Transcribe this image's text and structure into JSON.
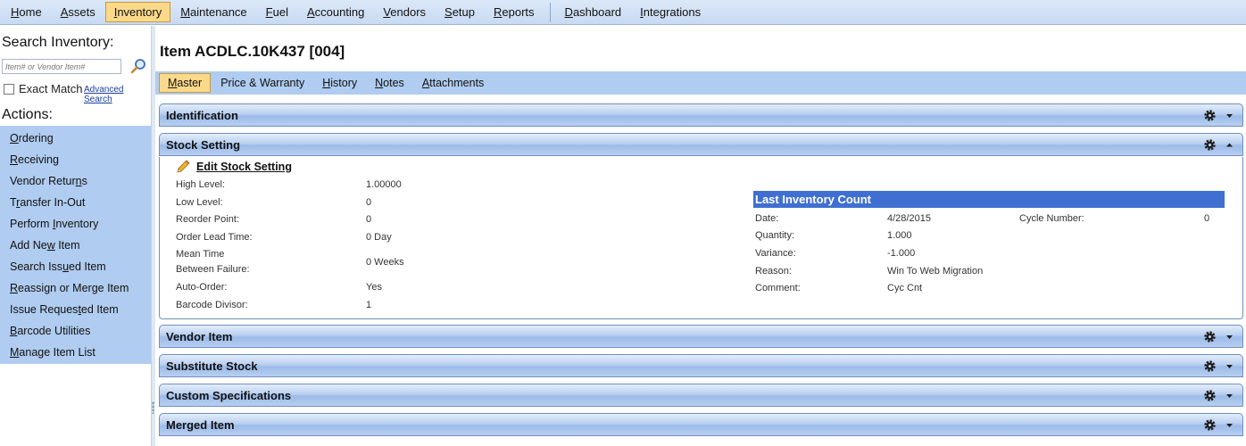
{
  "menu": {
    "items": [
      {
        "label": "Home",
        "key": "H",
        "rest": "ome"
      },
      {
        "label": "Assets",
        "key": "A",
        "rest": "ssets"
      },
      {
        "label": "Inventory",
        "key": "I",
        "rest": "nventory"
      },
      {
        "label": "Maintenance",
        "key": "M",
        "rest": "aintenance"
      },
      {
        "label": "Fuel",
        "key": "F",
        "rest": "uel"
      },
      {
        "label": "Accounting",
        "key": "A",
        "rest": "ccounting"
      },
      {
        "label": "Vendors",
        "key": "V",
        "rest": "endors"
      },
      {
        "label": "Setup",
        "key": "S",
        "rest": "etup"
      },
      {
        "label": "Reports",
        "key": "R",
        "rest": "eports"
      },
      {
        "label": "Dashboard",
        "key": "D",
        "rest": "ashboard"
      },
      {
        "label": "Integrations",
        "key": "I",
        "rest": "ntegrations"
      }
    ]
  },
  "sidebar": {
    "search_heading": "Search Inventory:",
    "search_placeholder": "Item# or Vendor Item#",
    "exact_match_label": "Exact Match",
    "advanced_search_label": "Advanced Search",
    "actions_heading": "Actions:",
    "actions": [
      {
        "pre": "",
        "key": "O",
        "post": "rdering"
      },
      {
        "pre": "",
        "key": "R",
        "post": "eceiving"
      },
      {
        "pre": "Vendor Retur",
        "key": "n",
        "post": "s"
      },
      {
        "pre": "T",
        "key": "r",
        "post": "ansfer In-Out"
      },
      {
        "pre": "Perform ",
        "key": "I",
        "post": "nventory"
      },
      {
        "pre": "Add Ne",
        "key": "w",
        "post": " Item"
      },
      {
        "pre": "Search Iss",
        "key": "u",
        "post": "ed Item"
      },
      {
        "pre": "",
        "key": "R",
        "post": "eassign or Merge Item"
      },
      {
        "pre": "Issue Reques",
        "key": "t",
        "post": "ed Item"
      },
      {
        "pre": "",
        "key": "B",
        "post": "arcode Utilities"
      },
      {
        "pre": "",
        "key": "M",
        "post": "anage Item List"
      }
    ]
  },
  "page": {
    "title": "Item ACDLC.10K437 [004]"
  },
  "tabs": [
    {
      "pre": "",
      "key": "M",
      "post": "aster"
    },
    {
      "pre": "Price & Warranty",
      "key": "",
      "post": ""
    },
    {
      "pre": "",
      "key": "H",
      "post": "istory"
    },
    {
      "pre": "",
      "key": "N",
      "post": "otes"
    },
    {
      "pre": "",
      "key": "A",
      "post": "ttachments"
    }
  ],
  "panels": {
    "identification": "Identification",
    "stock_setting": "Stock Setting",
    "vendor_item": "Vendor Item",
    "substitute_stock": "Substitute Stock",
    "custom_specifications": "Custom Specifications",
    "merged_item": "Merged Item"
  },
  "stock_setting": {
    "edit_label": "Edit Stock Setting",
    "fields": {
      "high_level": {
        "label": "High Level:",
        "value": "1.00000"
      },
      "low_level": {
        "label": "Low Level:",
        "value": "0"
      },
      "reorder_point": {
        "label": "Reorder Point:",
        "value": "0"
      },
      "order_lead_time": {
        "label": "Order Lead Time:",
        "value": "0 Day"
      },
      "mtbf": {
        "label_line1": "Mean Time",
        "label_line2": "Between Failure:",
        "value": "0 Weeks"
      },
      "auto_order": {
        "label": "Auto-Order:",
        "value": "Yes"
      },
      "barcode_divisor": {
        "label": "Barcode Divisor:",
        "value": "1"
      }
    },
    "last_inventory_count": {
      "title": "Last Inventory Count",
      "date": {
        "label": "Date:",
        "value": "4/28/2015"
      },
      "quantity": {
        "label": "Quantity:",
        "value": "1.000"
      },
      "variance": {
        "label": "Variance:",
        "value": "-1.000"
      },
      "reason": {
        "label": "Reason:",
        "value": "Win To Web Migration"
      },
      "comment": {
        "label": "Comment:",
        "value": "Cyc Cnt"
      },
      "cycle_number": {
        "label": "Cycle Number:",
        "value": "0"
      }
    }
  }
}
